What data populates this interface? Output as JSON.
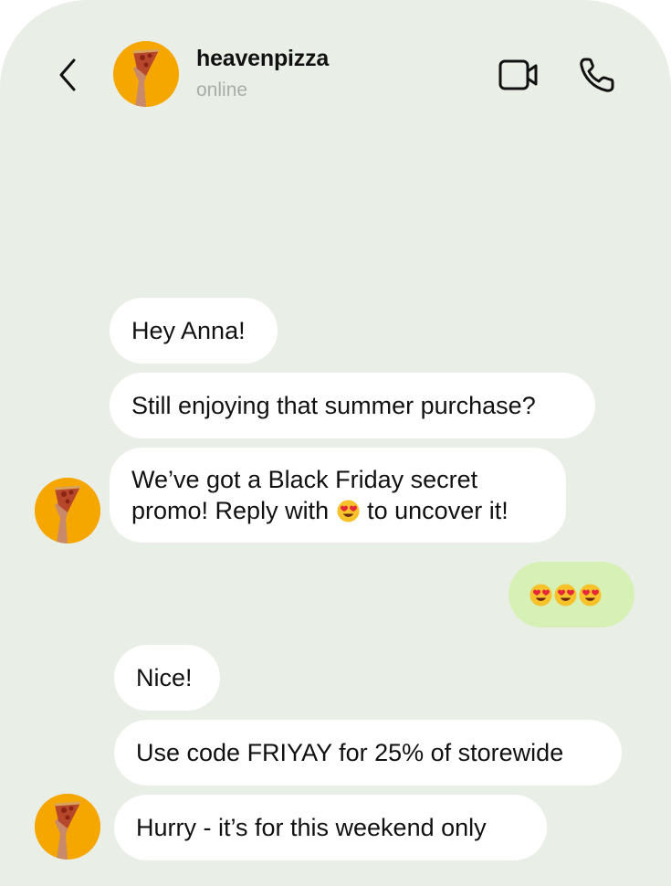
{
  "header": {
    "contact_name": "heavenpizza",
    "status": "online"
  },
  "messages": [
    {
      "direction": "incoming",
      "text": "Hey Anna!"
    },
    {
      "direction": "incoming",
      "text": "Still enjoying that summer purchase?"
    },
    {
      "direction": "incoming",
      "line1": "We’ve got a Black Friday secret",
      "line2_pre": "promo! Reply with",
      "line2_emoji": "heart-eyes-emoji",
      "line2_post": "to uncover it!"
    },
    {
      "direction": "outgoing",
      "emojis": [
        "heart-eyes-emoji",
        "heart-eyes-emoji",
        "heart-eyes-emoji"
      ]
    },
    {
      "direction": "incoming",
      "text": "Nice!"
    },
    {
      "direction": "incoming",
      "text": "Use code FRIYAY for 25% of storewide"
    },
    {
      "direction": "incoming",
      "text": "Hurry - it’s for this weekend only"
    }
  ],
  "icons": {
    "back": "chevron-left-icon",
    "video": "video-camera-icon",
    "call": "phone-icon"
  },
  "colors": {
    "background": "#e9efe6",
    "incoming_bubble": "#ffffff",
    "outgoing_bubble": "#d7f0b6",
    "avatar": "#f5a700"
  }
}
